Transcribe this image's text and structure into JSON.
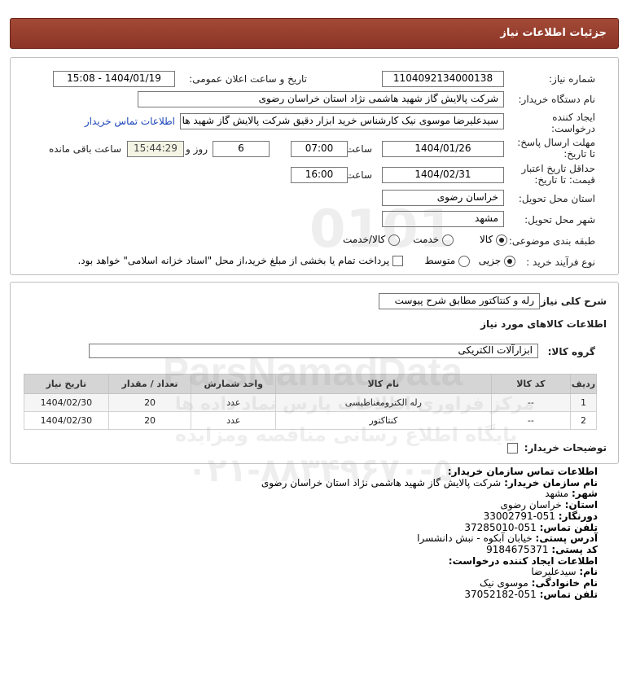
{
  "header": {
    "title": "جزئیات اطلاعات نیاز"
  },
  "form": {
    "need_number": {
      "label": "شماره نیاز:",
      "value": "1104092134000138"
    },
    "announce": {
      "label": "تاریخ و ساعت اعلان عمومی:",
      "value": "1404/01/19 - 15:08"
    },
    "buyer_org": {
      "label": "نام دستگاه خریدار:",
      "value": "شرکت پالایش گاز شهید هاشمی نژاد   استان خراسان رضوی"
    },
    "creator": {
      "label_line1": "ایجاد کننده",
      "label_line2": "درخواست:",
      "value": "سیدعلیرضا موسوی نیک کارشناس خرید ابزار دقیق شرکت پالایش گاز شهید ها",
      "link": "اطلاعات تماس خریدار"
    },
    "reply_deadline": {
      "label_line1": "مهلت ارسال پاسخ:",
      "label_line2": "تا تاریخ:",
      "date": "1404/01/26",
      "time_label": "ساعت",
      "time": "07:00",
      "days": "6",
      "days_label": "روز و",
      "remaining": "15:44:29",
      "remaining_label": "ساعت باقی مانده"
    },
    "price_validity": {
      "label_line1": "حداقل تاریخ اعتبار",
      "label_line2": "قیمت: تا تاریخ:",
      "date": "1404/02/31",
      "time_label": "ساعت",
      "time": "16:00"
    },
    "delivery_province": {
      "label": "استان محل تحویل:",
      "value": "خراسان رضوی"
    },
    "delivery_city": {
      "label": "شهر محل تحویل:",
      "value": "مشهد"
    },
    "category": {
      "label": "طبقه بندی موضوعی:",
      "options": [
        "کالا",
        "خدمت",
        "کالا/خدمت"
      ],
      "selected": "کالا"
    },
    "purchase_type": {
      "label": "نوع فرآیند خرید :",
      "options": [
        "جزیی",
        "متوسط"
      ],
      "selected": "جزیی",
      "payment_note": "پرداخت تمام یا بخشی از مبلغ خرید،از محل \"اسناد خزانه اسلامی\" خواهد بود."
    }
  },
  "summary": {
    "label": "شرح کلی نیاز:",
    "value": "رله و کنتاکتور مطابق شرح پیوست",
    "items_title": "اطلاعات کالاهای مورد نیاز",
    "group_label": "گروه کالا:",
    "group_value": "ابزارآلات الکتریکی"
  },
  "table": {
    "headers": [
      "ردیف",
      "کد کالا",
      "نام کالا",
      "واحد شمارش",
      "تعداد / مقدار",
      "تاریخ نیاز"
    ],
    "rows": [
      [
        "1",
        "--",
        "رله الکترومغناطیسی",
        "عدد",
        "20",
        "1404/02/30"
      ],
      [
        "2",
        "--",
        "کنتاکتور",
        "عدد",
        "20",
        "1404/02/30"
      ]
    ]
  },
  "buyer_notes": {
    "label": "توضیحات خریدار:"
  },
  "contact": {
    "title": "اطلاعات تماس سازمان خریدار:",
    "org_label": "نام سازمان خریدار:",
    "org": "شرکت پالایش گاز شهید هاشمی نژاد استان خراسان رضوی",
    "city_label": "شهر:",
    "city": "مشهد",
    "province_label": "استان:",
    "province": "خراسان رضوی",
    "fax_label": "دورنگار:",
    "fax": "051-33002791",
    "phone_label": "تلفن تماس:",
    "phone": "051-37285010",
    "address_label": "آدرس پستی:",
    "address": "خیابان آبکوه - نبش دانشسرا",
    "postal_label": "کد پستی:",
    "postal": "9184675371",
    "creator_title": "اطلاعات ایجاد کننده درخواست:",
    "name_label": "نام:",
    "name": "سیدعلیرضا",
    "family_label": "نام خانوادگی:",
    "family": "موسوی نیک",
    "creator_phone_label": "تلفن تماس:",
    "creator_phone": "051-37052182"
  },
  "watermark": {
    "number": "0101",
    "brand": "ParsNamadData",
    "line1": "مرکز فراوری اطلاعات پارس نماد داده ها",
    "line2": "پایگاه اطلاع رسانی مناقصه ومزایده",
    "phone": "۰۲۱-۸۸۳۴۹۶۷۰-۵"
  }
}
